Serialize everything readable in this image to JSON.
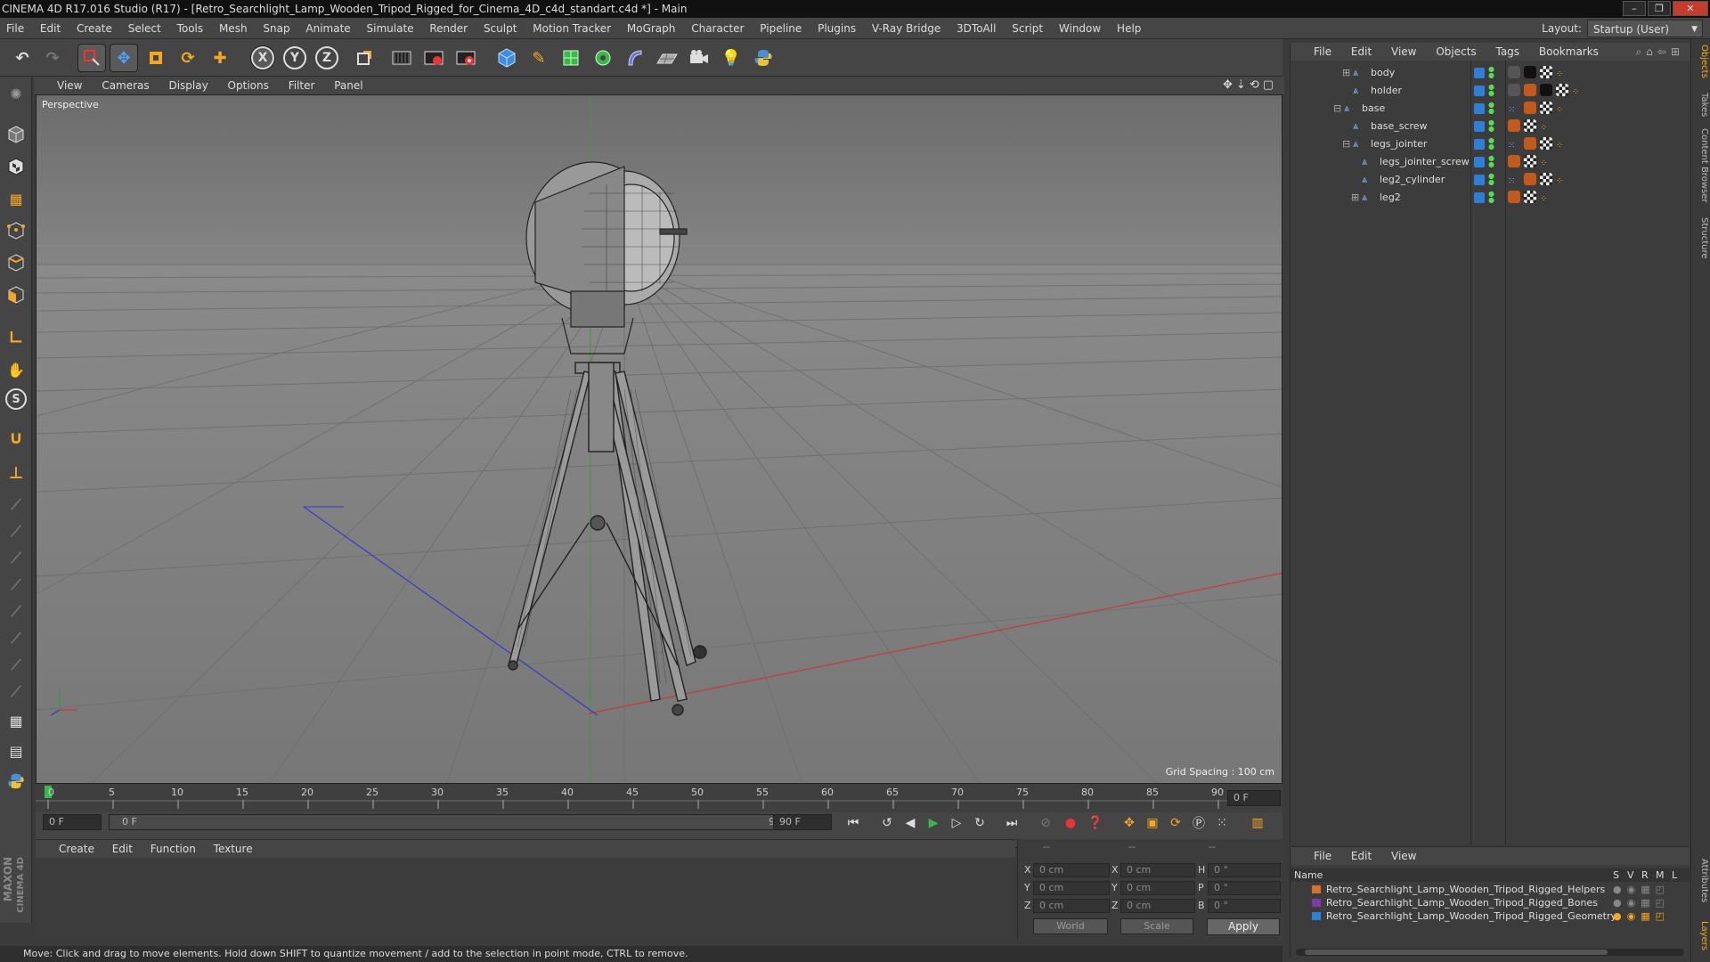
{
  "window": {
    "title": "CINEMA 4D R17.016 Studio (R17) - [Retro_Searchlight_Lamp_Wooden_Tripod_Rigged_for_Cinema_4D_c4d_standart.c4d *] - Main",
    "buttons": [
      "–",
      "❐",
      "✕"
    ]
  },
  "menubar": {
    "items": [
      "File",
      "Edit",
      "Create",
      "Select",
      "Tools",
      "Mesh",
      "Snap",
      "Animate",
      "Simulate",
      "Render",
      "Sculpt",
      "Motion Tracker",
      "MoGraph",
      "Character",
      "Pipeline",
      "Plugins",
      "V-Ray Bridge",
      "3DToAll",
      "Script",
      "Window",
      "Help"
    ],
    "layout_label": "Layout:",
    "layout_value": "Startup (User)"
  },
  "toolbar": {
    "icons": [
      "undo-icon",
      "redo-icon",
      "live-selection-icon",
      "move-icon",
      "scale-icon",
      "rotate-icon",
      "move-alt-icon",
      "x-axis-icon",
      "y-axis-icon",
      "z-axis-icon",
      "world-coords-icon",
      "render-view-icon",
      "render-picture-queue-icon",
      "render-settings-icon",
      "cube-icon",
      "pen-icon",
      "subdivision-icon",
      "cloner-icon",
      "deformer-icon",
      "floor-icon",
      "camera-icon",
      "light-icon",
      "python-icon"
    ],
    "axis_labels": [
      "X",
      "Y",
      "Z"
    ]
  },
  "viewport": {
    "menu": [
      "View",
      "Cameras",
      "Display",
      "Options",
      "Filter",
      "Panel"
    ],
    "label": "Perspective",
    "grid_spacing": "Grid Spacing : 100 cm"
  },
  "timeline": {
    "ticks": [
      "0",
      "5",
      "10",
      "15",
      "20",
      "25",
      "30",
      "35",
      "40",
      "45",
      "50",
      "55",
      "60",
      "65",
      "70",
      "75",
      "80",
      "85",
      "90"
    ],
    "current_frame": "0 F",
    "start_field": "0 F",
    "range_start": "0 F",
    "range_end": "90 F",
    "end_field": "90 F"
  },
  "materials": {
    "menu": [
      "Create",
      "Edit",
      "Function",
      "Texture"
    ]
  },
  "coordinates": {
    "header": [
      "--",
      "--",
      "--"
    ],
    "rows": [
      {
        "axis": "X",
        "pos": "0 cm",
        "axis2": "X",
        "size": "0 cm",
        "rot_label": "H",
        "rot": "0 °"
      },
      {
        "axis": "Y",
        "pos": "0 cm",
        "axis2": "Y",
        "size": "0 cm",
        "rot_label": "P",
        "rot": "0 °"
      },
      {
        "axis": "Z",
        "pos": "0 cm",
        "axis2": "Z",
        "size": "0 cm",
        "rot_label": "B",
        "rot": "0 °"
      }
    ],
    "mode_select": "World",
    "type_select": "Scale",
    "apply": "Apply"
  },
  "status": {
    "text": "Move: Click and drag to move elements. Hold down SHIFT to quantize movement / add to the selection in point mode, CTRL to remove."
  },
  "brand": {
    "line1": "MAXON",
    "line2": "CINEMA 4D"
  },
  "objects": {
    "menu": [
      "File",
      "Edit",
      "View",
      "Objects",
      "Tags",
      "Bookmarks"
    ],
    "rows": [
      {
        "name": "body",
        "indent": 4,
        "expander": "+"
      },
      {
        "name": "holder",
        "indent": 4,
        "expander": ""
      },
      {
        "name": "base",
        "indent": 3,
        "expander": "−"
      },
      {
        "name": "base_screw",
        "indent": 4,
        "expander": ""
      },
      {
        "name": "legs_jointer",
        "indent": 4,
        "expander": "−"
      },
      {
        "name": "legs_jointer_screw",
        "indent": 5,
        "expander": ""
      },
      {
        "name": "leg2_cylinder",
        "indent": 5,
        "expander": ""
      },
      {
        "name": "leg2",
        "indent": 5,
        "expander": "+"
      }
    ]
  },
  "layers": {
    "menu": [
      "File",
      "Edit",
      "View"
    ],
    "header": {
      "name": "Name",
      "cols": [
        "S",
        "V",
        "R",
        "M",
        "L"
      ]
    },
    "rows": [
      {
        "name": "Retro_Searchlight_Lamp_Wooden_Tripod_Rigged_Helpers",
        "color": "#d8702a"
      },
      {
        "name": "Retro_Searchlight_Lamp_Wooden_Tripod_Rigged_Bones",
        "color": "#7a3aa8"
      },
      {
        "name": "Retro_Searchlight_Lamp_Wooden_Tripod_Rigged_Geometry",
        "color": "#2d7fd8"
      }
    ]
  },
  "side_tabs": [
    "Objects",
    "Takes",
    "Content Browser",
    "Structure",
    "Attributes",
    "Layers"
  ]
}
